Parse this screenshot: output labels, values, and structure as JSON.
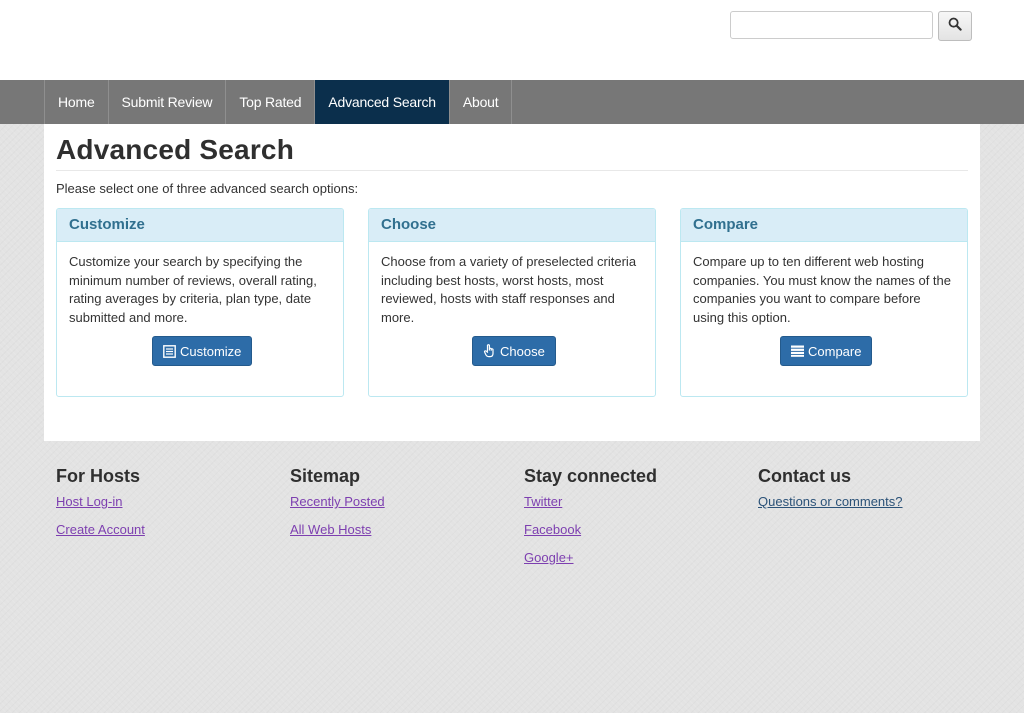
{
  "header": {
    "search_placeholder": "",
    "search_value": "",
    "search_icon": "search-icon"
  },
  "nav": {
    "items": [
      {
        "label": "Home",
        "active": false
      },
      {
        "label": "Submit Review",
        "active": false
      },
      {
        "label": "Top Rated",
        "active": false
      },
      {
        "label": "Advanced Search",
        "active": true
      },
      {
        "label": "About",
        "active": false
      }
    ]
  },
  "main": {
    "title": "Advanced Search",
    "intro": "Please select one of three advanced search options:",
    "panels": [
      {
        "heading": "Customize",
        "body": "Customize your search by specifying the minimum number of reviews, overall rating, rating averages by criteria, plan type, date submitted and more.",
        "button_label": "Customize",
        "button_icon": "list-alt-icon"
      },
      {
        "heading": "Choose",
        "body": "Choose from a variety of preselected criteria including best hosts, worst hosts, most reviewed, hosts with staff responses and more.",
        "button_label": "Choose",
        "button_icon": "hand-pointer-icon"
      },
      {
        "heading": "Compare",
        "body": "Compare up to ten different web hosting companies. You must know the names of the companies you want to compare before using this option.",
        "button_label": "Compare",
        "button_icon": "list-icon"
      }
    ]
  },
  "footer": {
    "columns": [
      {
        "heading": "For Hosts",
        "links": [
          "Host Log-in",
          "Create Account"
        ]
      },
      {
        "heading": "Sitemap",
        "links": [
          "Recently Posted",
          "All Web Hosts"
        ]
      },
      {
        "heading": "Stay connected",
        "links": [
          "Twitter",
          "Facebook",
          "Google+"
        ]
      },
      {
        "heading": "Contact us",
        "links": [
          "Questions or comments?"
        ]
      }
    ]
  },
  "colors": {
    "nav_background": "#777777",
    "nav_active": "#0b2f4c",
    "panel_heading_bg": "#d9edf7",
    "panel_heading_text": "#31708f",
    "panel_border": "#bce8f1",
    "button_primary": "#2d6ca8",
    "visited_link": "#7d3fb0",
    "link": "#2b5278"
  }
}
